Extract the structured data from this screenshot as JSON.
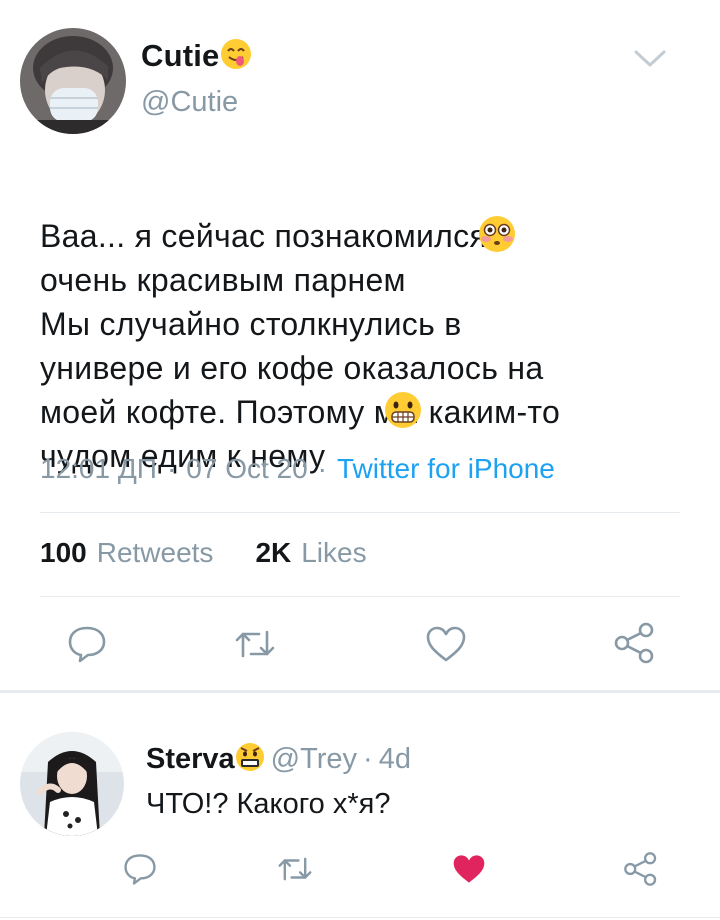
{
  "tweet": {
    "author_name": "Cutie",
    "author_handle": "@Cutie",
    "text": "Ваа... я сейчас познакомился с\nочень красивым парнем\nМы случайно столкнулись в\nунивере и его кофе оказалось на\nмоей кофте. Поэтому мы каким-то\nчудом едим к нему",
    "time": "12:01 ДП",
    "separator": "·",
    "date": "07 Oct 20",
    "source": "Twitter for iPhone",
    "retweets_count": "100",
    "retweets_label": "Retweets",
    "likes_count": "2K",
    "likes_label": "Likes"
  },
  "reply": {
    "author_name": "Sterva",
    "handle": "@Trey",
    "separator": "·",
    "age": "4d",
    "text": "ЧТО!? Какого х*я?",
    "liked": true
  },
  "icons": {
    "reply": "comment-icon",
    "retweet": "retweet-icon",
    "like": "heart-icon",
    "share": "share-icon",
    "menu": "chevron-down-icon"
  },
  "colors": {
    "accent": "#1da1f2",
    "muted": "#8899a6",
    "like_active": "#e0245e",
    "divider": "#e6ecf0"
  }
}
